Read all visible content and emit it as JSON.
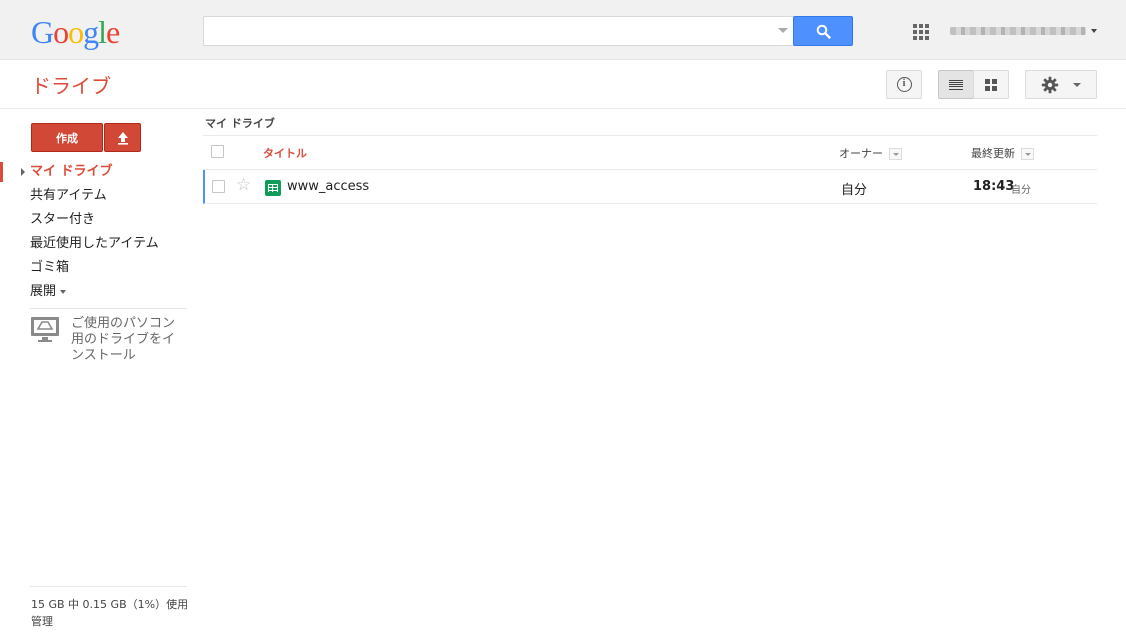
{
  "header": {
    "logo_letters": [
      {
        "ch": "G",
        "color": "#4285f4"
      },
      {
        "ch": "o",
        "color": "#ea4335"
      },
      {
        "ch": "o",
        "color": "#fbbc05"
      },
      {
        "ch": "g",
        "color": "#4285f4"
      },
      {
        "ch": "l",
        "color": "#34a853"
      },
      {
        "ch": "e",
        "color": "#ea4335"
      }
    ],
    "search": {
      "value": "",
      "placeholder": ""
    },
    "icons": {
      "search": "search-icon",
      "apps": "apps-grid-icon",
      "account": "account-menu-caret"
    }
  },
  "subheader": {
    "app_title": "ドライブ",
    "icons": [
      "info-icon",
      "list-view-icon",
      "grid-view-icon",
      "gear-icon"
    ]
  },
  "sidebar": {
    "create_label": "作成",
    "upload_icon": "upload-icon",
    "nav": [
      {
        "label": "マイ ドライブ",
        "active": true
      },
      {
        "label": "共有アイテム",
        "active": false
      },
      {
        "label": "スター付き",
        "active": false
      },
      {
        "label": "最近使用したアイテム",
        "active": false
      },
      {
        "label": "ゴミ箱",
        "active": false
      },
      {
        "label": "展開",
        "active": false
      }
    ],
    "install_text": "ご使用のパソコン用のドライブをインストール",
    "storage_text": "15 GB 中 0.15 GB（1%）使用",
    "manage_label": "管理"
  },
  "main": {
    "breadcrumb": "マイ ドライブ",
    "columns": {
      "title": "タイトル",
      "owner": "オーナー",
      "modified": "最終更新"
    },
    "files": [
      {
        "name": "www_access",
        "type": "spreadsheet",
        "owner": "自分",
        "modified_time": "18:43",
        "modified_by": "自分",
        "starred": false
      }
    ]
  },
  "colors": {
    "accent_red": "#dd4b39",
    "button_red": "#d14836",
    "search_blue": "#4d90fe",
    "sheet_green": "#0f9d58"
  }
}
